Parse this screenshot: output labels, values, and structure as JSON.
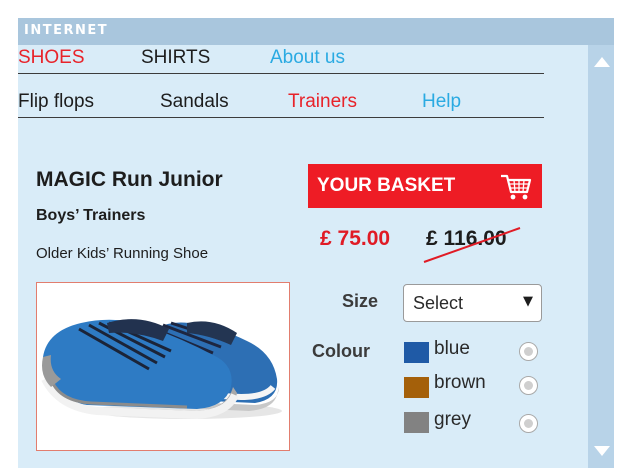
{
  "window": {
    "title": "INTERNET"
  },
  "nav_primary": [
    {
      "label": "SHOES",
      "color": "#e8232a"
    },
    {
      "label": "SHIRTS",
      "color": "#1d1d1d"
    },
    {
      "label": "About us",
      "color": "#2aaae2"
    }
  ],
  "nav_secondary": [
    {
      "label": "Flip flops",
      "color": "#1d1d1d"
    },
    {
      "label": "Sandals",
      "color": "#1d1d1d"
    },
    {
      "label": "Trainers",
      "color": "#e8232a"
    },
    {
      "label": "Help",
      "color": "#2aaae2"
    }
  ],
  "product": {
    "title": "MAGIC Run Junior",
    "subtitle": "Boys’ Trainers",
    "description": "Older Kids’ Running Shoe",
    "image_icon": "running-shoe-photo"
  },
  "basket": {
    "label": "YOUR BASKET",
    "icon": "shopping-cart-icon",
    "color": "#ee1c25"
  },
  "price": {
    "current": "£ 75.00",
    "was": "£ 116.00"
  },
  "options": {
    "size_label": "Size",
    "size_value": "Select",
    "colour_label": "Colour",
    "colours": [
      {
        "name": "blue",
        "swatch": "#1f5aa6"
      },
      {
        "name": "brown",
        "swatch": "#a4600a"
      },
      {
        "name": "grey",
        "swatch": "#828282"
      }
    ]
  }
}
